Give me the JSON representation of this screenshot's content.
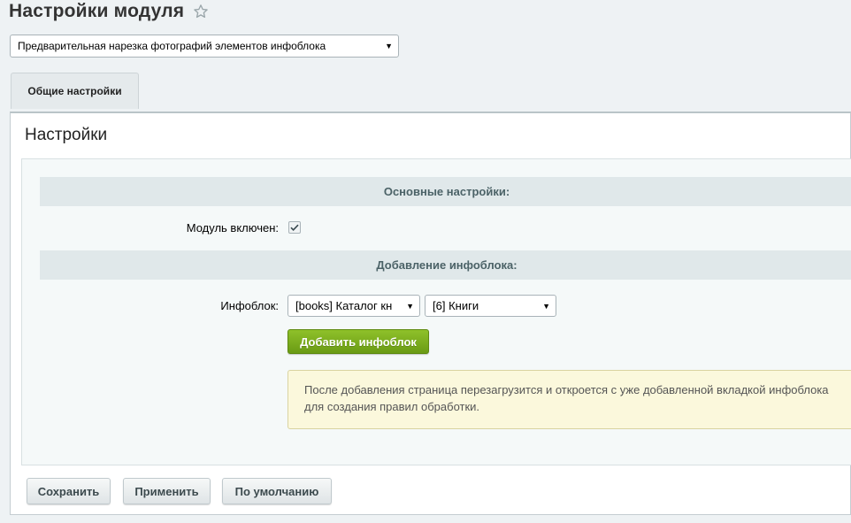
{
  "page": {
    "title": "Настройки модуля",
    "favorite_icon": "star-outline-icon"
  },
  "module_select": {
    "value": "Предварительная нарезка фотографий элементов инфоблока",
    "arrow": "▼"
  },
  "tabs": [
    {
      "label": "Общие настройки",
      "active": true
    }
  ],
  "panel": {
    "heading": "Настройки"
  },
  "sections": {
    "main": {
      "title": "Основные настройки:",
      "module_enabled_label": "Модуль включен:",
      "module_enabled_checked": true
    },
    "add_iblock": {
      "title": "Добавление инфоблока:",
      "iblock_label": "Инфоблок:",
      "type_select_value": "[books] Каталог кн",
      "iblock_select_value": "[6] Книги",
      "arrow": "▼",
      "add_button_label": "Добавить инфоблок",
      "notice_text": "После добавления страница перезагрузится и откроется с уже добавленной вкладкой инфоблока для создания правил обработки."
    }
  },
  "footer": {
    "save_label": "Сохранить",
    "apply_label": "Применить",
    "default_label": "По умолчанию"
  },
  "colors": {
    "accent_green": "#7aac1c",
    "section_header_bg": "#e0e8ea",
    "notice_bg": "#fbf8dc"
  }
}
